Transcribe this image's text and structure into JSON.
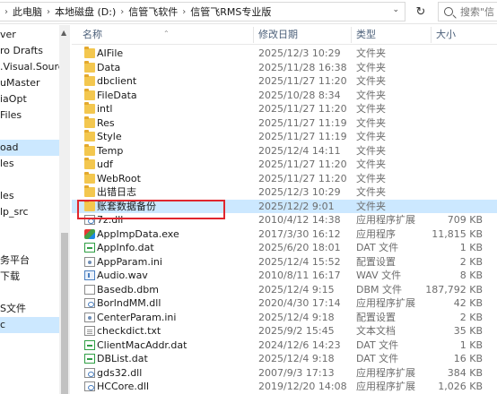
{
  "address_bar": {
    "crumbs": [
      "此电脑",
      "本地磁盘 (D:)",
      "信管飞软件",
      "信管飞RMS专业版"
    ],
    "search_placeholder": "搜索\"信"
  },
  "nav_pane": {
    "items": [
      {
        "label": "ver",
        "selected": false
      },
      {
        "label": "ro Drafts",
        "selected": false
      },
      {
        "label": ".Visual.SourceS",
        "selected": false
      },
      {
        "label": "uMaster",
        "selected": false
      },
      {
        "label": "iaOpt",
        "selected": false
      },
      {
        "label": "Files",
        "selected": false
      },
      {
        "label": "",
        "selected": false
      },
      {
        "label": "oad",
        "selected": true
      },
      {
        "label": "les",
        "selected": false
      },
      {
        "label": "",
        "selected": false
      },
      {
        "label": "les",
        "selected": false
      },
      {
        "label": "lp_src",
        "selected": false
      },
      {
        "label": "",
        "selected": false
      },
      {
        "label": "",
        "selected": false
      },
      {
        "label": "务平台",
        "selected": false
      },
      {
        "label": "下载",
        "selected": false
      },
      {
        "label": "",
        "selected": false
      },
      {
        "label": "S文件",
        "selected": false
      },
      {
        "label": "c",
        "selected": true
      }
    ]
  },
  "columns": {
    "name": "名称",
    "date": "修改日期",
    "type": "类型",
    "size": "大小"
  },
  "files": [
    {
      "icon": "folder",
      "name": "AIFile",
      "date": "2025/12/3 10:29",
      "type": "文件夹",
      "size": ""
    },
    {
      "icon": "folder",
      "name": "Data",
      "date": "2025/11/28 16:38",
      "type": "文件夹",
      "size": ""
    },
    {
      "icon": "folder",
      "name": "dbclient",
      "date": "2025/11/27 11:20",
      "type": "文件夹",
      "size": ""
    },
    {
      "icon": "folder",
      "name": "FileData",
      "date": "2025/10/28 8:34",
      "type": "文件夹",
      "size": ""
    },
    {
      "icon": "folder",
      "name": "intl",
      "date": "2025/11/27 11:20",
      "type": "文件夹",
      "size": ""
    },
    {
      "icon": "folder",
      "name": "Res",
      "date": "2025/11/27 11:19",
      "type": "文件夹",
      "size": ""
    },
    {
      "icon": "folder",
      "name": "Style",
      "date": "2025/11/27 11:19",
      "type": "文件夹",
      "size": ""
    },
    {
      "icon": "folder",
      "name": "Temp",
      "date": "2025/12/4 14:11",
      "type": "文件夹",
      "size": ""
    },
    {
      "icon": "folder",
      "name": "udf",
      "date": "2025/11/27 11:20",
      "type": "文件夹",
      "size": ""
    },
    {
      "icon": "folder",
      "name": "WebRoot",
      "date": "2025/11/27 11:20",
      "type": "文件夹",
      "size": ""
    },
    {
      "icon": "folder",
      "name": "出错日志",
      "date": "2025/12/3 10:29",
      "type": "文件夹",
      "size": ""
    },
    {
      "icon": "folder",
      "name": "账套数据备份",
      "date": "2025/12/2 9:01",
      "type": "文件夹",
      "size": "",
      "selected": true
    },
    {
      "icon": "dll",
      "name": "7z.dll",
      "date": "2010/4/12 14:38",
      "type": "应用程序扩展",
      "size": "709 KB"
    },
    {
      "icon": "exe",
      "name": "AppImpData.exe",
      "date": "2017/3/30 16:12",
      "type": "应用程序",
      "size": "11,815 KB"
    },
    {
      "icon": "dat",
      "name": "AppInfo.dat",
      "date": "2025/6/20 18:01",
      "type": "DAT 文件",
      "size": "1 KB"
    },
    {
      "icon": "ini",
      "name": "AppParam.ini",
      "date": "2025/12/4 15:52",
      "type": "配置设置",
      "size": "2 KB"
    },
    {
      "icon": "wav",
      "name": "Audio.wav",
      "date": "2010/8/11 16:17",
      "type": "WAV 文件",
      "size": "8 KB"
    },
    {
      "icon": "dbm",
      "name": "Basedb.dbm",
      "date": "2025/12/4 9:15",
      "type": "DBM 文件",
      "size": "187,792 KB"
    },
    {
      "icon": "dll",
      "name": "BorlndMM.dll",
      "date": "2020/4/30 17:14",
      "type": "应用程序扩展",
      "size": "42 KB"
    },
    {
      "icon": "ini",
      "name": "CenterParam.ini",
      "date": "2025/12/4 9:18",
      "type": "配置设置",
      "size": "2 KB"
    },
    {
      "icon": "doc",
      "name": "checkdict.txt",
      "date": "2025/9/2 15:45",
      "type": "文本文档",
      "size": "35 KB"
    },
    {
      "icon": "dat",
      "name": "ClientMacAddr.dat",
      "date": "2024/12/6 14:23",
      "type": "DAT 文件",
      "size": "1 KB"
    },
    {
      "icon": "dat",
      "name": "DBList.dat",
      "date": "2025/12/4 9:18",
      "type": "DAT 文件",
      "size": "16 KB"
    },
    {
      "icon": "dll",
      "name": "gds32.dll",
      "date": "2007/9/3 17:13",
      "type": "应用程序扩展",
      "size": "384 KB"
    },
    {
      "icon": "dll",
      "name": "HCCore.dll",
      "date": "2019/12/20 14:08",
      "type": "应用程序扩展",
      "size": "1,026 KB"
    }
  ]
}
